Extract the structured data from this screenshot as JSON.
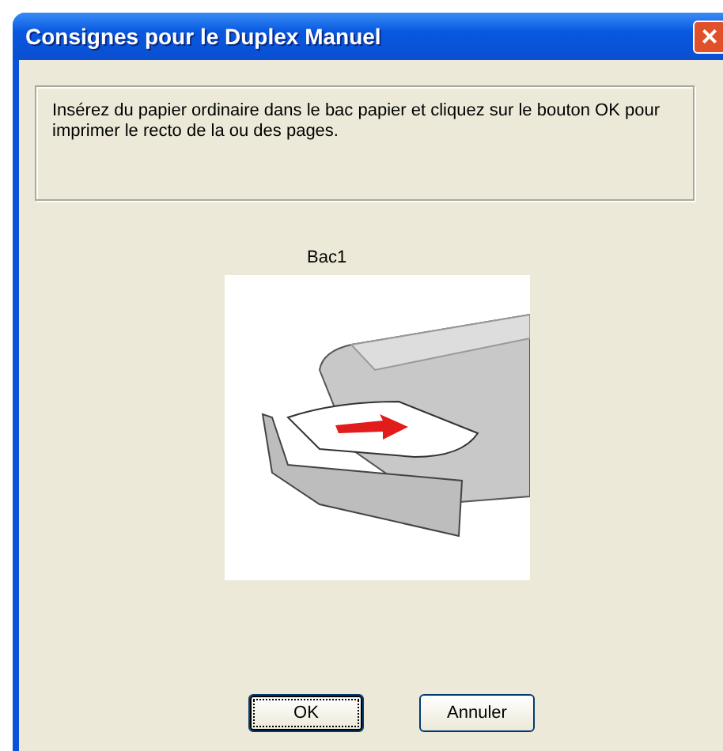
{
  "window": {
    "title": "Consignes pour le Duplex Manuel",
    "close": "×"
  },
  "message": "Insérez du papier ordinaire dans le bac papier et cliquez sur le bouton OK pour imprimer le recto de la ou des pages.",
  "tray_label": "Bac1",
  "buttons": [
    {
      "label": "OK",
      "focused": true
    },
    {
      "label": "Annuler",
      "focused": false
    }
  ]
}
